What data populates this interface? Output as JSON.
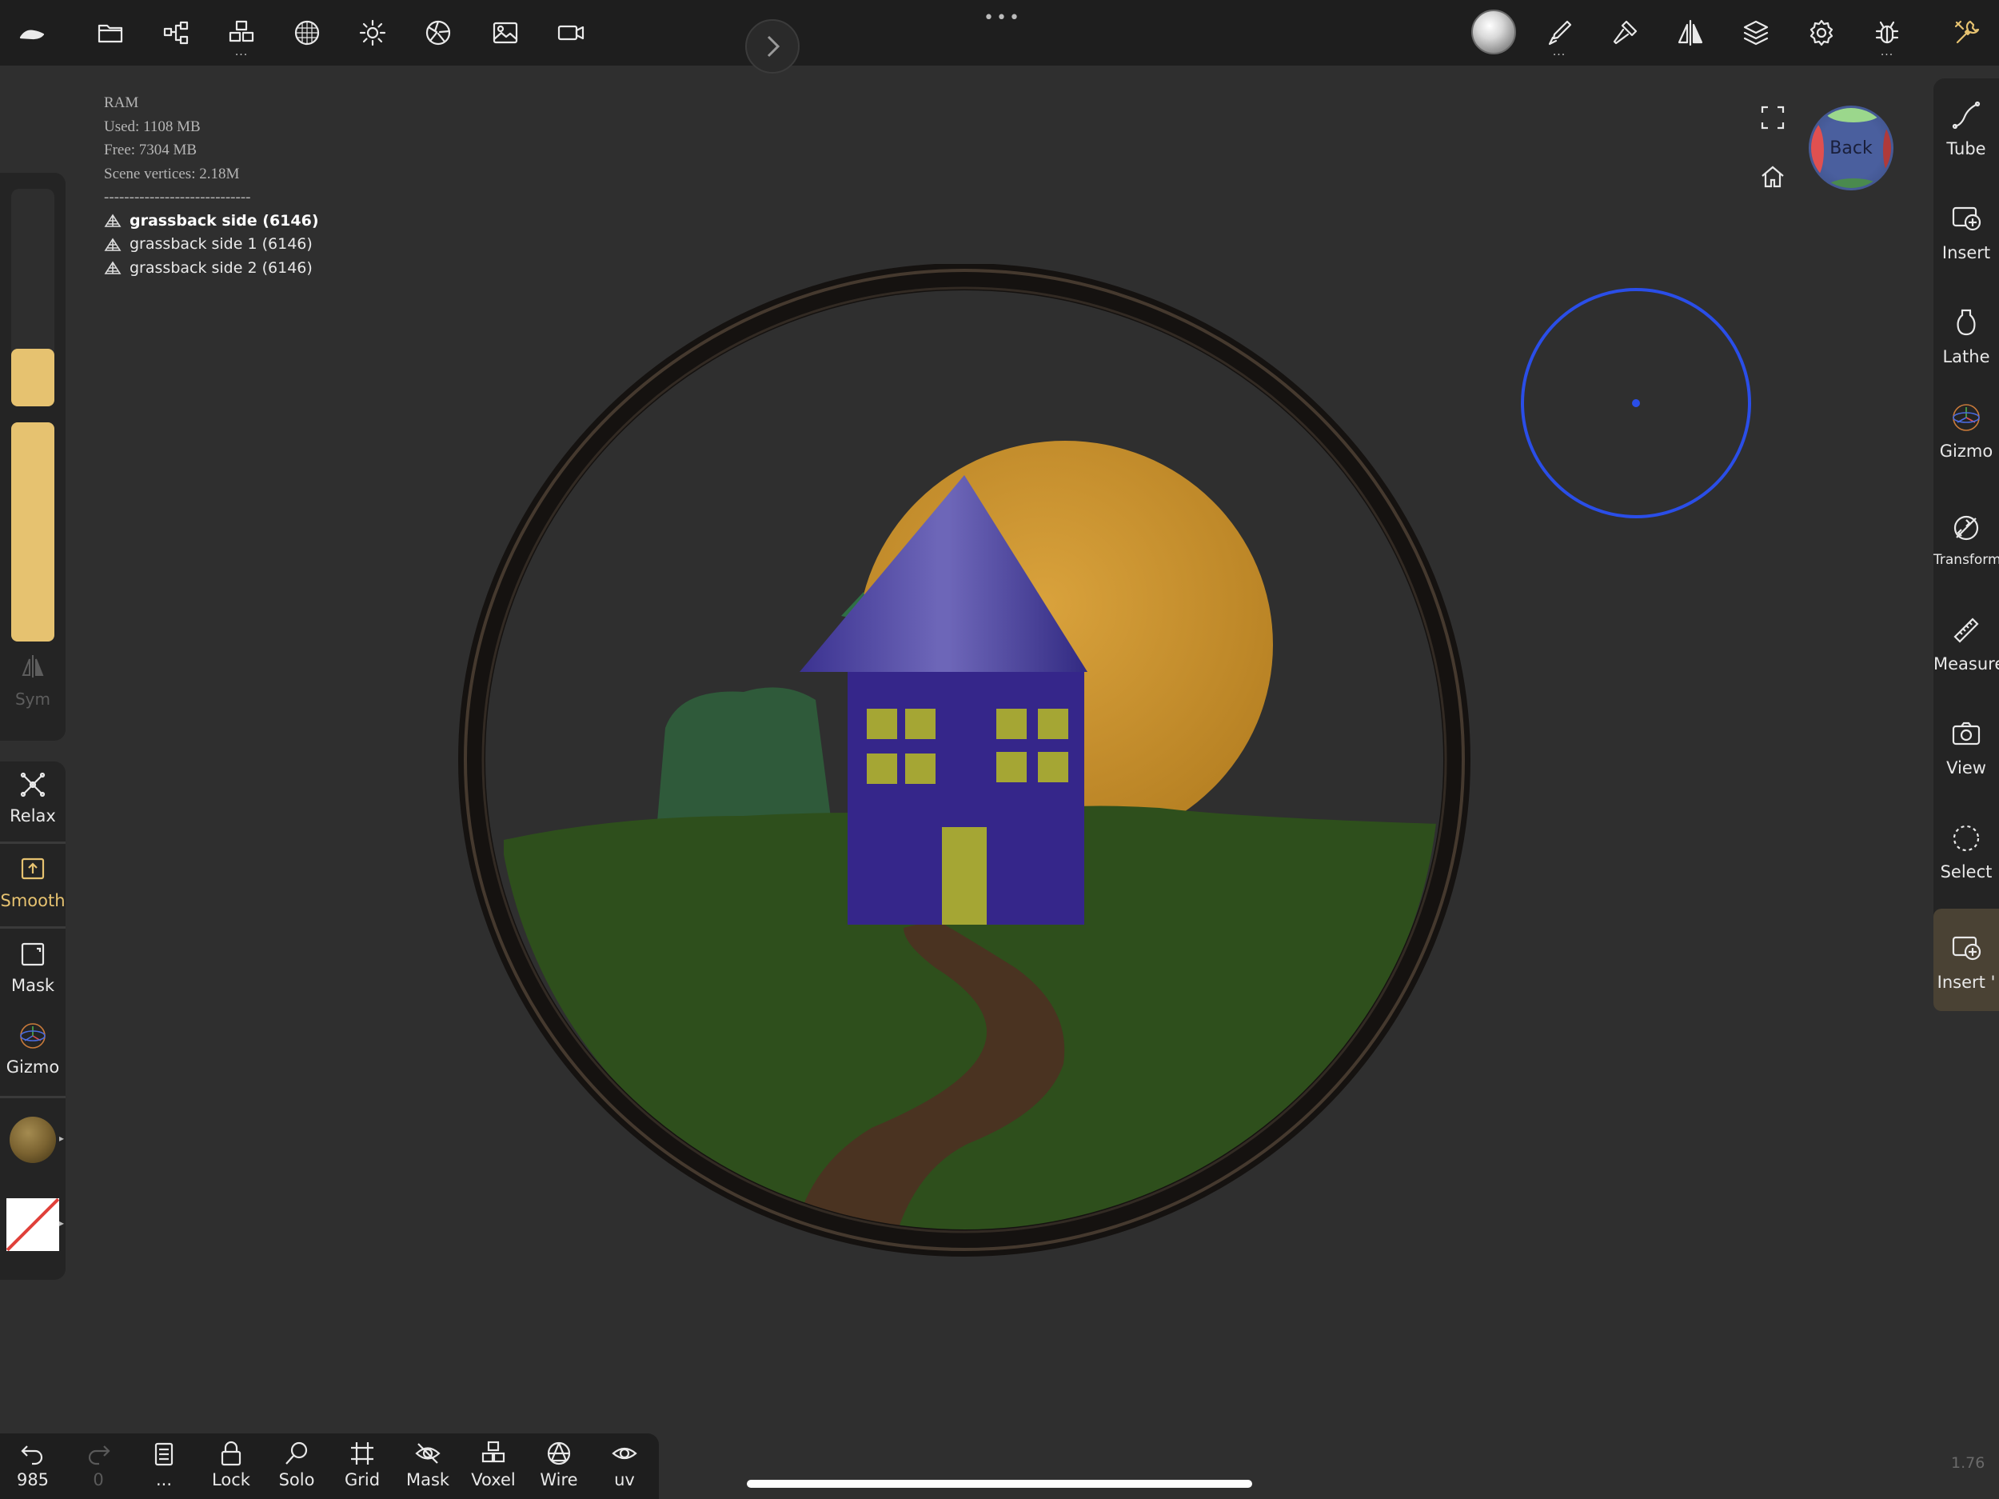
{
  "top_toolbar": {
    "more_indicator": "•••"
  },
  "stats": {
    "ram_label": "RAM",
    "used": "Used: 1108 MB",
    "free": "Free: 7304 MB",
    "scene_vertices": "Scene vertices: 2.18M",
    "separator": "-----------------------------",
    "objects": [
      "grassback side (6146)",
      "grassback side 1 (6146)",
      "grassback side 2 (6146)"
    ]
  },
  "left_panel": {
    "sym_label": "Sym"
  },
  "left_tools": {
    "relax": "Relax",
    "smooth": "Smooth",
    "mask": "Mask",
    "gizmo": "Gizmo"
  },
  "right_panel": {
    "items": [
      "Tube",
      "Insert",
      "Lathe",
      "Gizmo",
      "Transform",
      "Measure",
      "View",
      "Select",
      "Insert '"
    ]
  },
  "viewcube": {
    "label": "Back"
  },
  "bottom_bar": {
    "undo_count": "985",
    "redo_count": "0",
    "history_label": "...",
    "lock": "Lock",
    "solo": "Solo",
    "grid": "Grid",
    "mask": "Mask",
    "voxel": "Voxel",
    "wire": "Wire",
    "uv": "uv"
  },
  "version": "1.76",
  "colors": {
    "accent": "#e6c270",
    "brush_circle": "#2a4ee8",
    "background": "#2f2f2f",
    "panel": "#242424"
  }
}
